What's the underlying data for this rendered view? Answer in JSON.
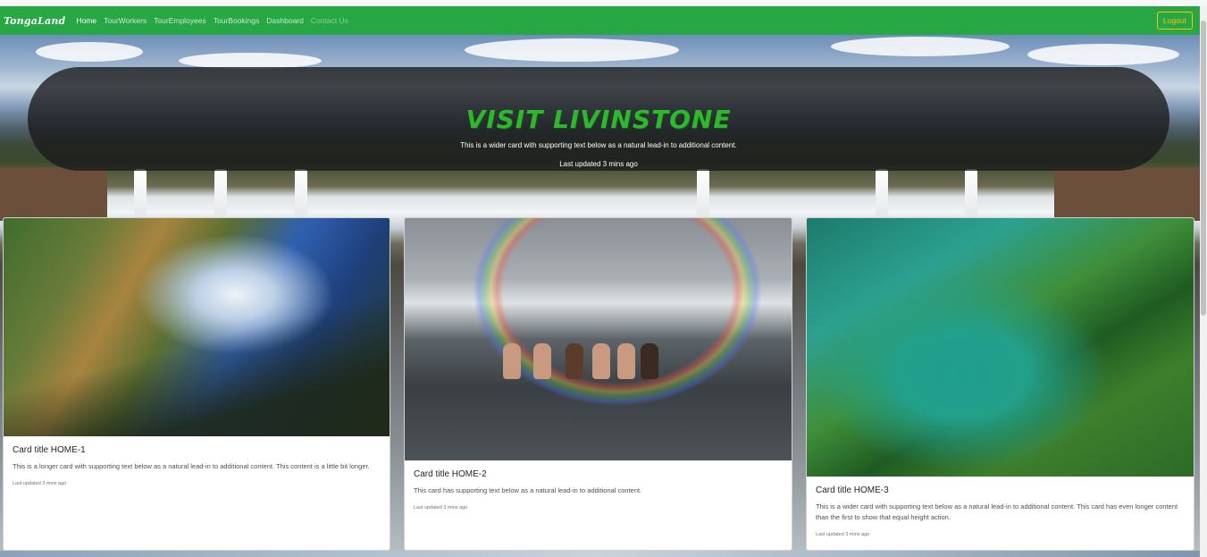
{
  "navbar": {
    "brand": "TongaLand",
    "links": [
      "Home",
      "TourWorkers",
      "TourEmployees",
      "TourBookings",
      "Dashboard",
      "Contact Us"
    ],
    "logout_label": "Logout"
  },
  "jumbotron": {
    "title": "VISIT LIVINSTONE",
    "text": "This is a wider card with supporting text below as a natural lead-in to additional content.",
    "updated": "Last updated 3 mins ago"
  },
  "cards": [
    {
      "title": "Card title HOME-1",
      "text": "This is a longer card with supporting text below as a natural lead-in to additional content. This content is a little bit longer.",
      "updated": "Last updated 3 mins ago"
    },
    {
      "title": "Card title HOME-2",
      "text": "This card has supporting text below as a natural lead-in to additional content.",
      "updated": "Last updated 3 mins ago"
    },
    {
      "title": "Card title HOME-3",
      "text": "This is a wider card with supporting text below as a natural lead-in to additional content. This card has even longer content than the first to show that equal height action.",
      "updated": "Last updated 3 mins ago"
    }
  ],
  "colors": {
    "navbar": "#28a745",
    "logout_border": "#ffc107",
    "title_green": "#2eb82e"
  }
}
